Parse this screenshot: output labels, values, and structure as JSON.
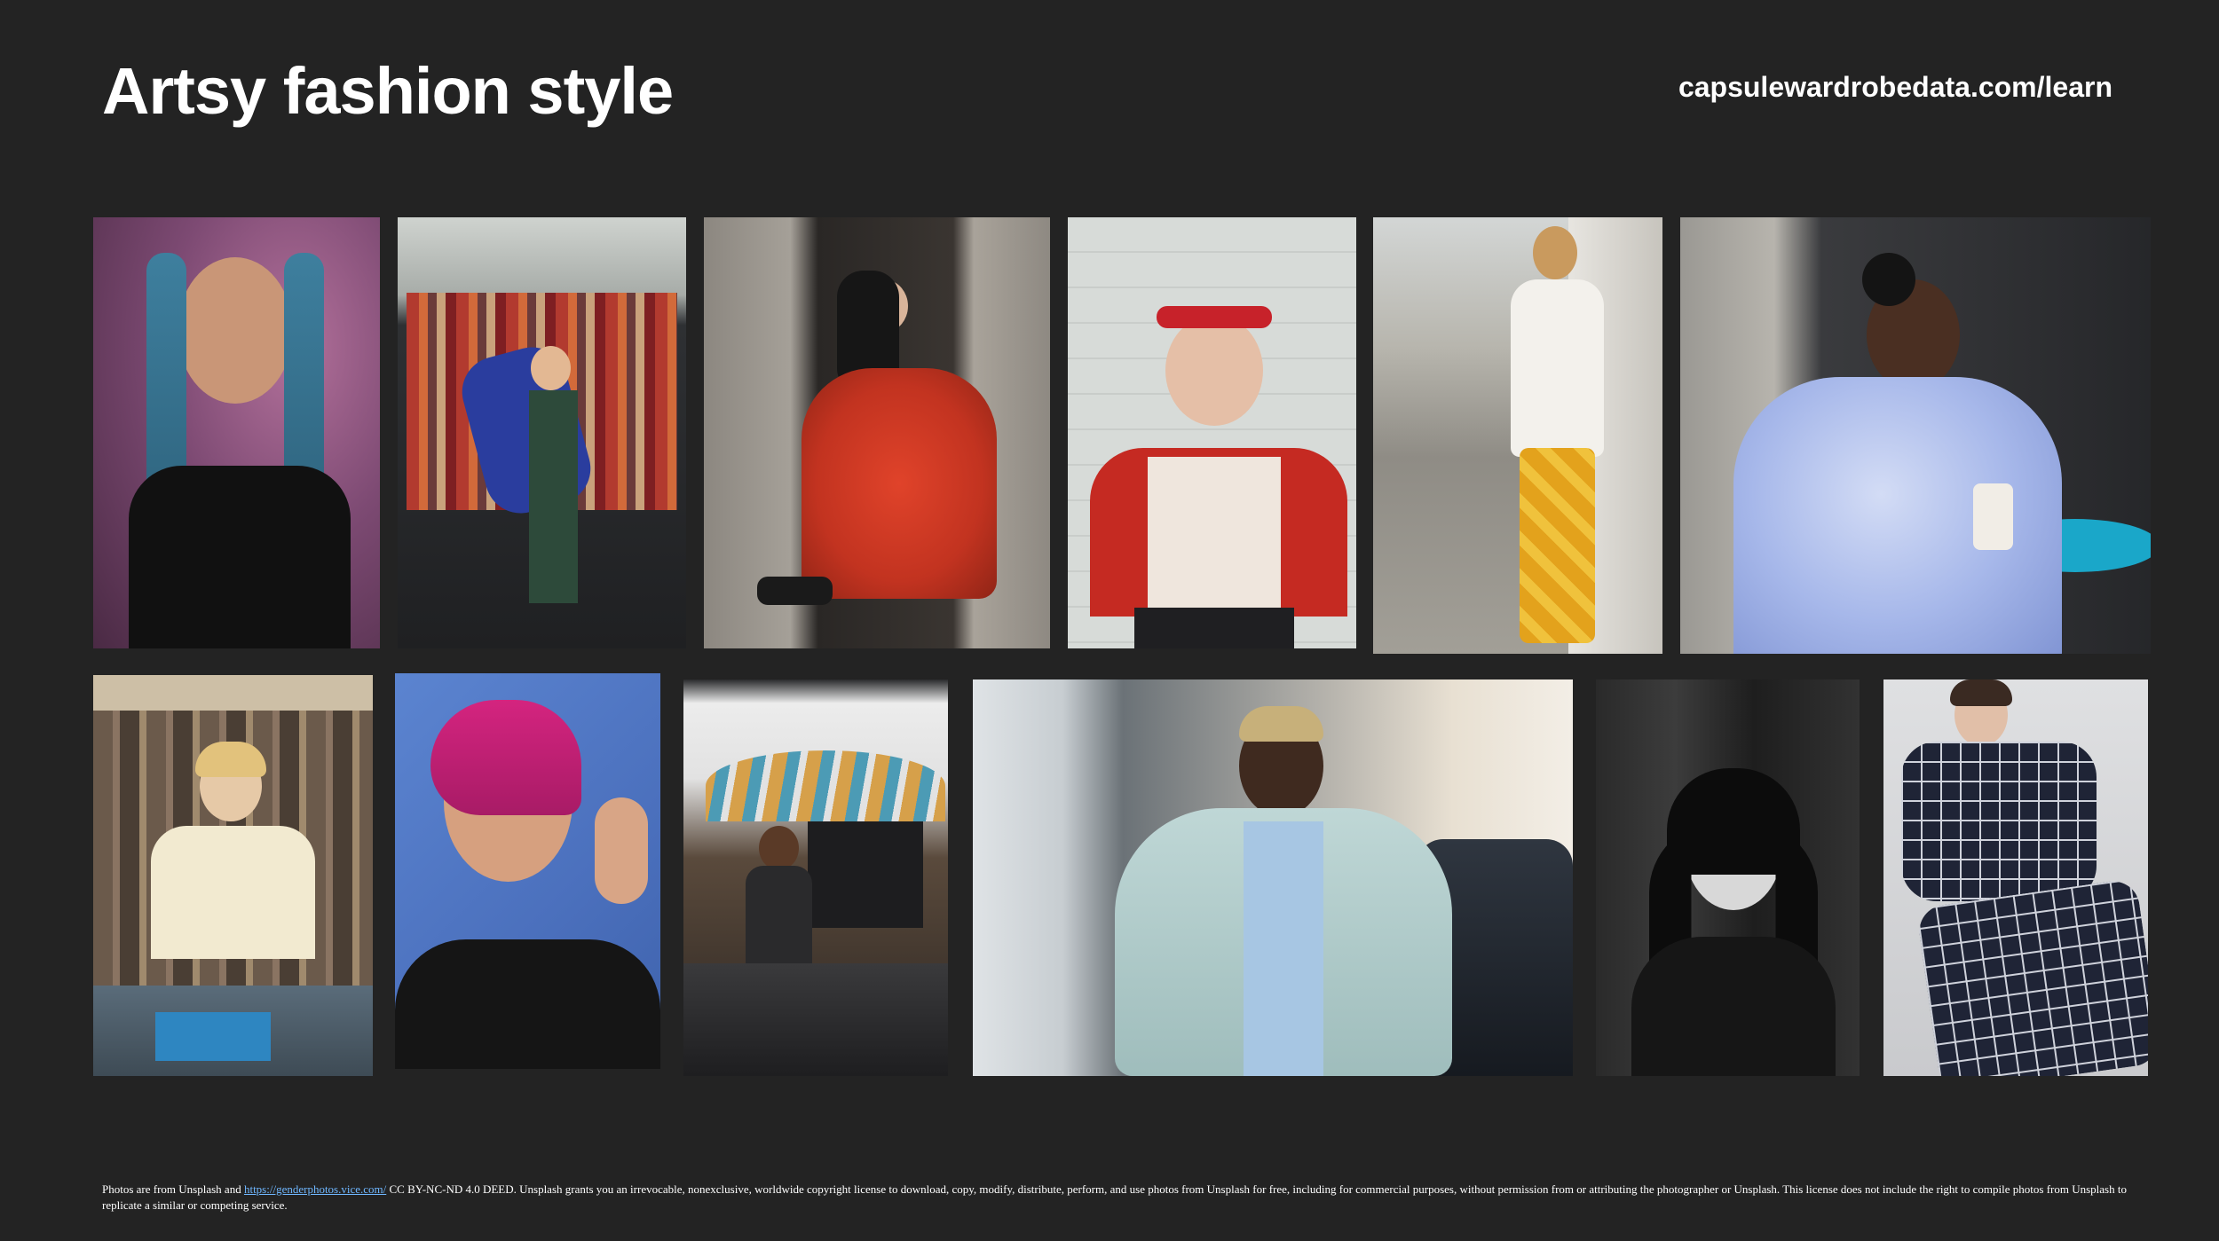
{
  "header": {
    "title": "Artsy fashion style",
    "site": "capsulewardrobedata.com/learn"
  },
  "colors": {
    "background": "#232323",
    "text": "#ffffff",
    "link": "#6fb7ff"
  },
  "photos": [
    {
      "subject": "woman-blue-braids"
    },
    {
      "subject": "woman-clothing-rack"
    },
    {
      "subject": "woman-red-tulle-skirt"
    },
    {
      "subject": "woman-cherry-top-sunglasses"
    },
    {
      "subject": "man-yellow-pants-walking"
    },
    {
      "subject": "person-blue-fur-coat"
    },
    {
      "subject": "woman-record-store"
    },
    {
      "subject": "woman-pink-hair"
    },
    {
      "subject": "person-cafe"
    },
    {
      "subject": "man-shearling-jacket"
    },
    {
      "subject": "woman-black-white-sunglasses"
    },
    {
      "subject": "person-checkered-outfit"
    }
  ],
  "footer": {
    "prefix": "Photos are from Unsplash and ",
    "link_text": "https://genderphotos.vice.com/",
    "suffix": " CC BY-NC-ND 4.0 DEED. Unsplash grants you an irrevocable, nonexclusive, worldwide copyright license to download, copy, modify, distribute, perform, and use photos from Unsplash for free, including for commercial purposes, without permission from or attributing the photographer or Unsplash. This license does not include the right to compile photos from Unsplash to replicate a similar or competing service."
  }
}
